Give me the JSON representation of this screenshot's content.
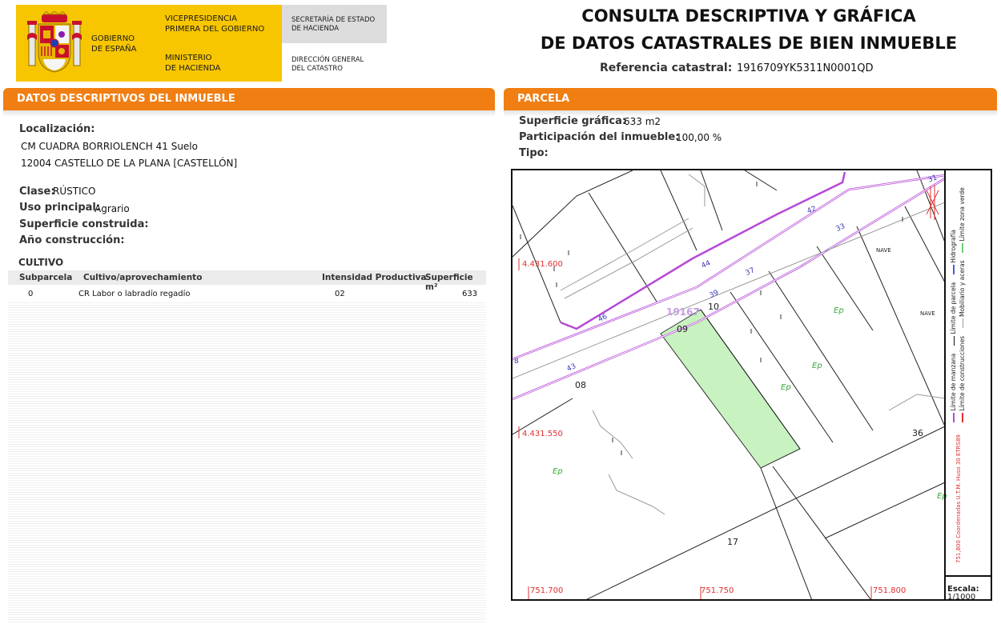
{
  "header": {
    "gobierno": [
      "GOBIERNO",
      "DE ESPAÑA"
    ],
    "vicepresidencia": [
      "VICEPRESIDENCIA",
      "PRIMERA DEL GOBIERNO"
    ],
    "ministerio": [
      "MINISTERIO",
      "DE HACIENDA"
    ],
    "secretaria": [
      "SECRETARÍA DE ESTADO",
      "DE HACIENDA"
    ],
    "direccion": [
      "DIRECCIÓN GENERAL",
      "DEL CATASTRO"
    ],
    "title_line1": "CONSULTA DESCRIPTIVA Y GRÁFICA",
    "title_line2": "DE DATOS CATASTRALES DE BIEN INMUEBLE",
    "ref_label": "Referencia catastral:",
    "ref_value": "1916709YK5311N0001QD"
  },
  "descriptive": {
    "heading": "DATOS DESCRIPTIVOS DEL INMUEBLE",
    "localizacion_label": "Localización:",
    "address_line1": "CM CUADRA BORRIOLENCH 41 Suelo",
    "address_line2": "12004 CASTELLO DE LA PLANA [CASTELLÓN]",
    "clase_label": "Clase:",
    "clase_value": "RÚSTICO",
    "uso_label": "Uso principal:",
    "uso_value": "Agrario",
    "superficie_label": "Superficie construida:",
    "anio_label": "Año construcción:"
  },
  "cultivo": {
    "title": "CULTIVO",
    "headers": [
      "Subparcela",
      "Cultivo/aprovechamiento",
      "Intensidad Productiva",
      "Superficie m²"
    ],
    "rows": [
      [
        "0",
        "CR Labor o labradío regadío",
        "02",
        "633"
      ]
    ]
  },
  "parcela": {
    "heading": "PARCELA",
    "superficie_label": "Superficie gráfica:",
    "superficie_value": "633 m2",
    "participacion_label": "Participación del inmueble:",
    "participacion_value": "100,00 %",
    "tipo_label": "Tipo:"
  },
  "map": {
    "y_coord_top": "4.431.600",
    "y_coord_bottom": "4.431.550",
    "x_coords": [
      "751.700",
      "751.750",
      "751.800"
    ],
    "parcel_numbers": [
      "10",
      "09",
      "08",
      "17",
      "36"
    ],
    "highlight_label": "19167",
    "nave_labels": [
      "NAVE",
      "NAVE"
    ],
    "ep_label": "Ep",
    "street_numbers": [
      "31",
      "42",
      "33",
      "44",
      "37",
      "39",
      "46",
      "43",
      "8"
    ],
    "highlight_color": "#c8f2c0",
    "street_color": "#b64ad6",
    "coord_color": "#e03030"
  },
  "legend": {
    "col1": [
      "Límite de manzana",
      "Límite de parcela",
      "Hidrografía"
    ],
    "col2": [
      "Límite de construcciones",
      "Mobiliario y aceras",
      "Límite zona verde"
    ],
    "coords_note": "751,800 Coordenadas U.T.M. Huso 30 ETRS89",
    "scale_label": "Escala:",
    "scale_value": "1/1000"
  }
}
